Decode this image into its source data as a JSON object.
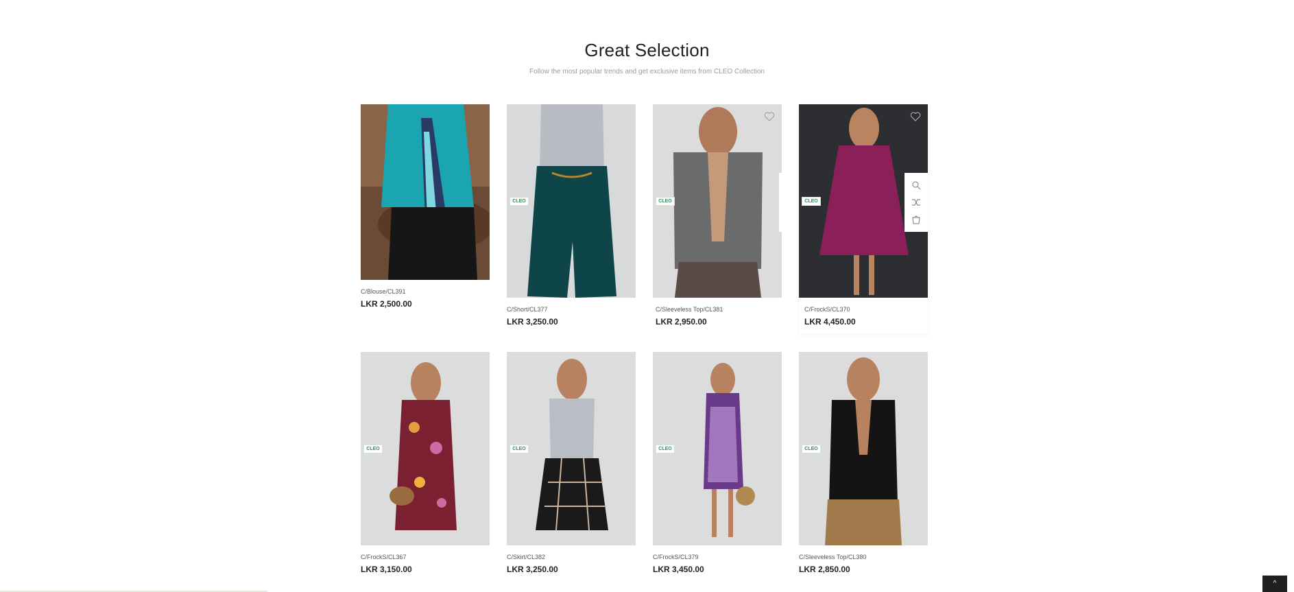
{
  "section": {
    "title": "Great Selection",
    "subtitle": "Follow the most popular trends and get exclusive items from CLEO Collection"
  },
  "badge_text": "CLEO",
  "products": [
    {
      "name": "C/Blouse/CL391",
      "price": "LKR 2,500.00"
    },
    {
      "name": "C/Short/CL377",
      "price": "LKR 3,250.00"
    },
    {
      "name": "C/Sleeveless Top/CL381",
      "price": "LKR 2,950.00"
    },
    {
      "name": "C/FrockS/CL370",
      "price": "LKR 4,450.00"
    },
    {
      "name": "C/FrockS/CL367",
      "price": "LKR 3,150.00"
    },
    {
      "name": "C/Skirt/CL382",
      "price": "LKR 3,250.00"
    },
    {
      "name": "C/FrockS/CL379",
      "price": "LKR 3,450.00"
    },
    {
      "name": "C/Sleeveless Top/CL380",
      "price": "LKR 2,850.00"
    }
  ],
  "icons": [
    "heart-icon",
    "zoom-icon",
    "compare-icon",
    "cart-icon",
    "chevron-up-icon"
  ],
  "colors": {
    "accent": "#1f1f1f",
    "badge_green": "#3a8a5c",
    "price": "#222222"
  },
  "back_to_top": "^"
}
